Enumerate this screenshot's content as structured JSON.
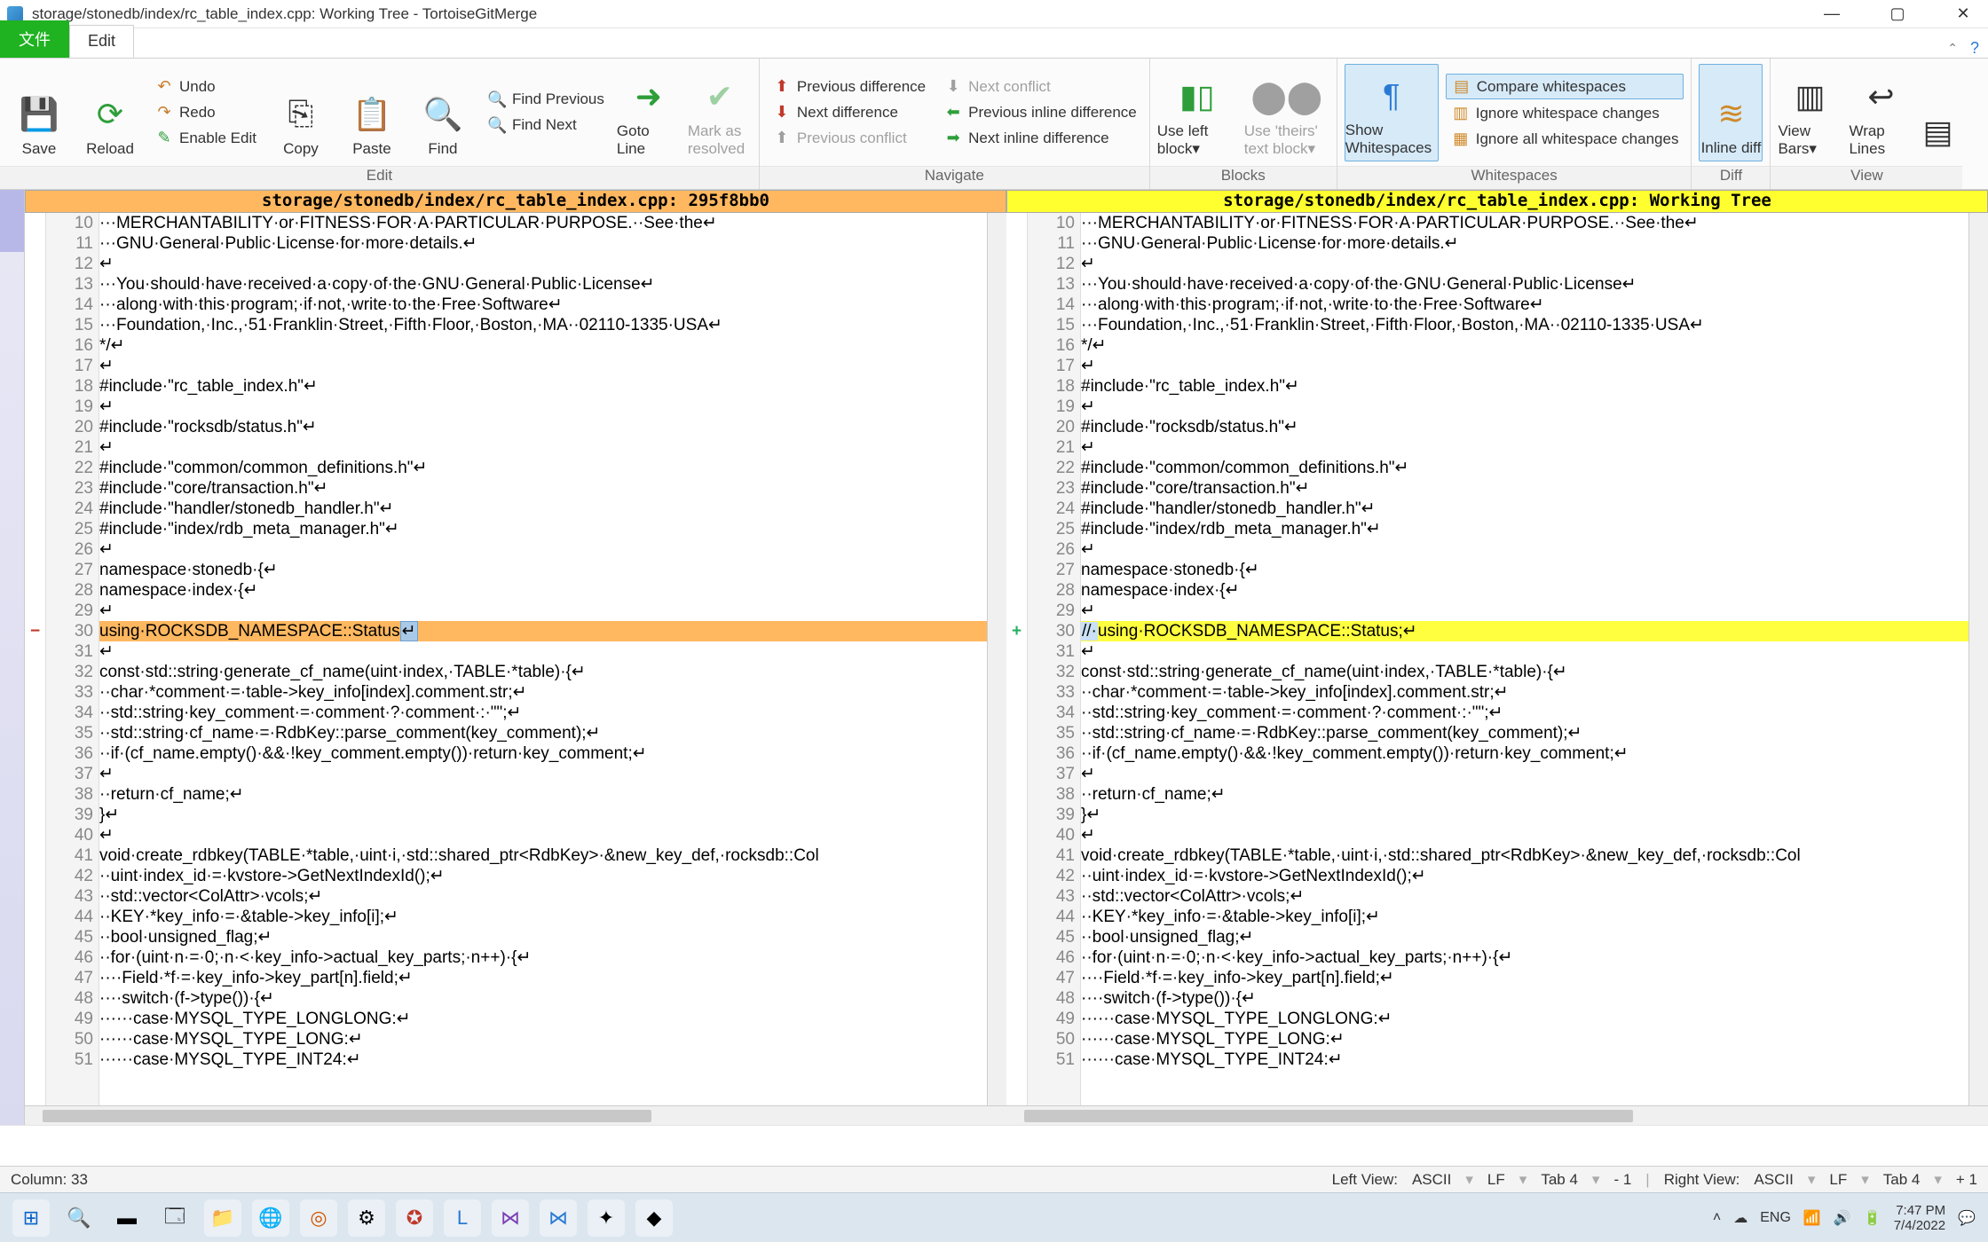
{
  "window": {
    "title": "storage/stonedb/index/rc_table_index.cpp: Working Tree - TortoiseGitMerge"
  },
  "tabs": {
    "file": "文件",
    "edit": "Edit"
  },
  "ribbon": {
    "save": "Save",
    "reload": "Reload",
    "undo": "Undo",
    "redo": "Redo",
    "enable_edit": "Enable Edit",
    "copy": "Copy",
    "paste": "Paste",
    "find": "Find",
    "find_prev": "Find Previous",
    "find_next": "Find Next",
    "goto": "Goto Line",
    "mark": "Mark as resolved",
    "prev_diff": "Previous difference",
    "next_diff": "Next difference",
    "prev_conf": "Previous conflict",
    "next_conf": "Next conflict",
    "prev_inline": "Previous inline difference",
    "next_inline": "Next inline difference",
    "use_left": "Use left block▾",
    "use_theirs": "Use 'theirs' text block▾",
    "show_ws": "Show Whitespaces",
    "cmp_ws": "Compare whitespaces",
    "ign_ws": "Ignore whitespace changes",
    "ign_all_ws": "Ignore all whitespace changes",
    "inline_diff": "Inline diff",
    "view_bars": "View Bars▾",
    "wrap": "Wrap Lines",
    "grp_edit": "Edit",
    "grp_nav": "Navigate",
    "grp_blocks": "Blocks",
    "grp_ws": "Whitespaces",
    "grp_diff": "Diff",
    "grp_view": "View"
  },
  "headers": {
    "left": "storage/stonedb/index/rc_table_index.cpp: 295f8bb0",
    "right": "storage/stonedb/index/rc_table_index.cpp: Working Tree"
  },
  "line_start": 10,
  "left_lines": [
    "···MERCHANTABILITY·or·FITNESS·FOR·A·PARTICULAR·PURPOSE.··See·the↵",
    "···GNU·General·Public·License·for·more·details.↵",
    "↵",
    "···You·should·have·received·a·copy·of·the·GNU·General·Public·License↵",
    "···along·with·this·program;·if·not,·write·to·the·Free·Software↵",
    "···Foundation,·Inc.,·51·Franklin·Street,·Fifth·Floor,·Boston,·MA··02110-1335·USA↵",
    "*/↵",
    "↵",
    "#include·\"rc_table_index.h\"↵",
    "↵",
    "#include·\"rocksdb/status.h\"↵",
    "↵",
    "#include·\"common/common_definitions.h\"↵",
    "#include·\"core/transaction.h\"↵",
    "#include·\"handler/stonedb_handler.h\"↵",
    "#include·\"index/rdb_meta_manager.h\"↵",
    "↵",
    "namespace·stonedb·{↵",
    "namespace·index·{↵",
    "↵",
    "using·ROCKSDB_NAMESPACE::Status;",
    "↵",
    "const·std::string·generate_cf_name(uint·index,·TABLE·*table)·{↵",
    "··char·*comment·=·table->key_info[index].comment.str;↵",
    "··std::string·key_comment·=·comment·?·comment·:·\"\";↵",
    "··std::string·cf_name·=·RdbKey::parse_comment(key_comment);↵",
    "··if·(cf_name.empty()·&&·!key_comment.empty())·return·key_comment;↵",
    "↵",
    "··return·cf_name;↵",
    "}↵",
    "↵",
    "void·create_rdbkey(TABLE·*table,·uint·i,·std::shared_ptr<RdbKey>·&new_key_def,·rocksdb::Col",
    "··uint·index_id·=·kvstore->GetNextIndexId();↵",
    "··std::vector<ColAttr>·vcols;↵",
    "··KEY·*key_info·=·&table->key_info[i];↵",
    "··bool·unsigned_flag;↵",
    "··for·(uint·n·=·0;·n·<·key_info->actual_key_parts;·n++)·{↵",
    "····Field·*f·=·key_info->key_part[n].field;↵",
    "····switch·(f->type())·{↵",
    "······case·MYSQL_TYPE_LONGLONG:↵",
    "······case·MYSQL_TYPE_LONG:↵",
    "······case·MYSQL_TYPE_INT24:↵"
  ],
  "right_lines": [
    "···MERCHANTABILITY·or·FITNESS·FOR·A·PARTICULAR·PURPOSE.··See·the↵",
    "···GNU·General·Public·License·for·more·details.↵",
    "↵",
    "···You·should·have·received·a·copy·of·the·GNU·General·Public·License↵",
    "···along·with·this·program;·if·not,·write·to·the·Free·Software↵",
    "···Foundation,·Inc.,·51·Franklin·Street,·Fifth·Floor,·Boston,·MA··02110-1335·USA↵",
    "*/↵",
    "↵",
    "#include·\"rc_table_index.h\"↵",
    "↵",
    "#include·\"rocksdb/status.h\"↵",
    "↵",
    "#include·\"common/common_definitions.h\"↵",
    "#include·\"core/transaction.h\"↵",
    "#include·\"handler/stonedb_handler.h\"↵",
    "#include·\"index/rdb_meta_manager.h\"↵",
    "↵",
    "namespace·stonedb·{↵",
    "namespace·index·{↵",
    "↵",
    "//·using·ROCKSDB_NAMESPACE::Status;",
    "↵",
    "const·std::string·generate_cf_name(uint·index,·TABLE·*table)·{↵",
    "··char·*comment·=·table->key_info[index].comment.str;↵",
    "··std::string·key_comment·=·comment·?·comment·:·\"\";↵",
    "··std::string·cf_name·=·RdbKey::parse_comment(key_comment);↵",
    "··if·(cf_name.empty()·&&·!key_comment.empty())·return·key_comment;↵",
    "↵",
    "··return·cf_name;↵",
    "}↵",
    "↵",
    "void·create_rdbkey(TABLE·*table,·uint·i,·std::shared_ptr<RdbKey>·&new_key_def,·rocksdb::Col",
    "··uint·index_id·=·kvstore->GetNextIndexId();↵",
    "··std::vector<ColAttr>·vcols;↵",
    "··KEY·*key_info·=·&table->key_info[i];↵",
    "··bool·unsigned_flag;↵",
    "··for·(uint·n·=·0;·n·<·key_info->actual_key_parts;·n++)·{↵",
    "····Field·*f·=·key_info->key_part[n].field;↵",
    "····switch·(f->type())·{↵",
    "······case·MYSQL_TYPE_LONGLONG:↵",
    "······case·MYSQL_TYPE_LONG:↵",
    "······case·MYSQL_TYPE_INT24:↵"
  ],
  "diff_index": 20,
  "status": {
    "column": "Column: 33",
    "left_view_label": "Left View:",
    "right_view_label": "Right View:",
    "enc": "ASCII",
    "eol": "LF",
    "tab": "Tab 4",
    "left_n": "- 1",
    "right_n": "+ 1"
  },
  "clock": {
    "time": "7:47 PM",
    "date": "7/4/2022"
  }
}
